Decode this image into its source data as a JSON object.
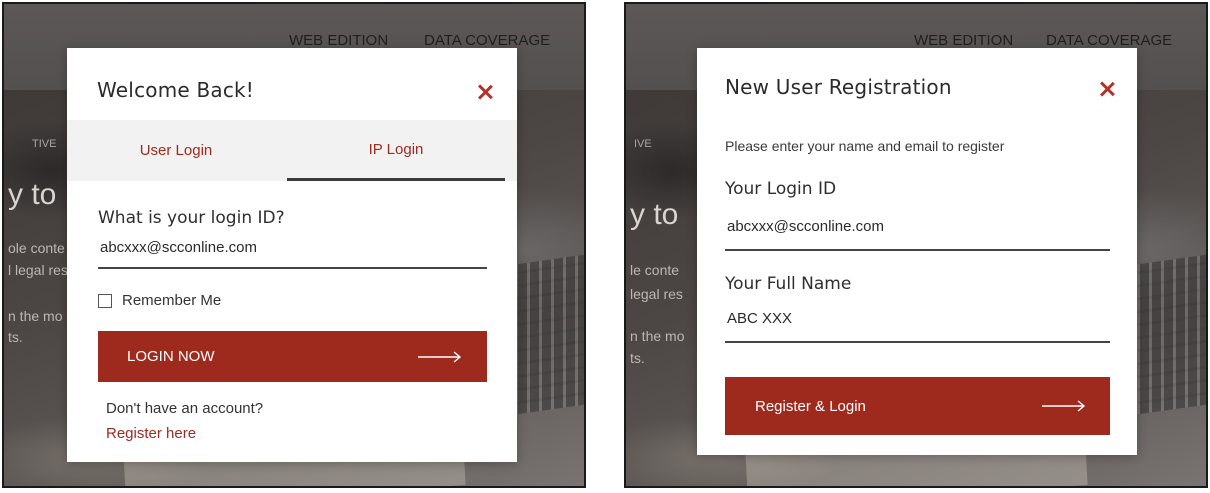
{
  "background": {
    "nav": {
      "web_edition": "WEB EDITION",
      "data_coverage": "DATA COVERAGE"
    },
    "left_fragments": {
      "tag": "TIVE",
      "headline": "y to",
      "line1": "ole conte",
      "line2": "l legal res",
      "line3": "n the mo",
      "line4": "ts."
    },
    "right_fragments": {
      "tag": "IVE",
      "headline": "y to",
      "line1": "le conte",
      "line2": "legal res",
      "line3": "n the mo",
      "line4": "ts."
    }
  },
  "login_modal": {
    "title": "Welcome Back!",
    "tabs": [
      {
        "label": "User Login",
        "active": false
      },
      {
        "label": "IP Login",
        "active": true
      }
    ],
    "login_id_label": "What is your login ID?",
    "login_id_value": "abcxxx@scconline.com",
    "remember_label": "Remember Me",
    "remember_checked": false,
    "submit_label": "LOGIN NOW",
    "no_account_text": "Don't have an account?",
    "register_link": "Register here"
  },
  "register_modal": {
    "title": "New User Registration",
    "instruction": "Please enter your name and email to register",
    "login_id_label": "Your Login ID",
    "login_id_value": "abcxxx@scconline.com",
    "full_name_label": "Your Full Name",
    "full_name_value": "ABC XXX",
    "submit_label": "Register & Login"
  },
  "colors": {
    "accent": "#9e2a1e",
    "overlay": "#5c5755",
    "tab_bar": "#f2f2f2"
  },
  "icons": [
    "close-icon",
    "arrow-right-icon",
    "checkbox-icon"
  ]
}
